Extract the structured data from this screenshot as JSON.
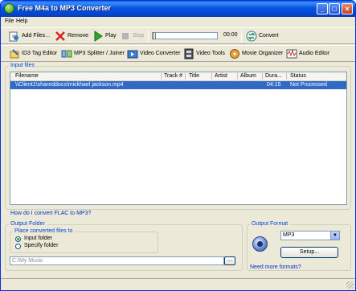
{
  "window": {
    "title": "Free M4a to MP3 Converter"
  },
  "menu": {
    "items": [
      "File",
      "Help"
    ]
  },
  "toolbar": {
    "add_files": "Add Files...",
    "remove": "Remove",
    "play": "Play",
    "stop": "Stop",
    "time": "00:00",
    "convert": "Convert"
  },
  "tools": {
    "items": [
      "ID3 Tag Editor",
      "MP3 Splitter / Joiner",
      "Video Converter",
      "Video Tools",
      "Movie Organizer",
      "Audio Editor"
    ]
  },
  "input_files": {
    "label": "Input files",
    "columns": [
      "Filename",
      "Track #",
      "Title",
      "Artist",
      "Album",
      "Dura...",
      "Status"
    ],
    "rows": [
      {
        "filename": "\\\\Client1\\shareddocs\\mickhael jackson.mp4",
        "track": "",
        "title": "",
        "artist": "",
        "album": "",
        "duration": "04:15",
        "status": "Not Processed"
      }
    ]
  },
  "help_link": "How do I convert FLAC to MP3?",
  "output_folder": {
    "label": "Output Folder",
    "place_label": "Place converted files to",
    "option_input": "Input folder",
    "option_specify": "Specify folder",
    "selected": "Input folder",
    "path_placeholder": "C:\\My Music",
    "browse": "..."
  },
  "output_format": {
    "label": "Output Format",
    "selected": "MP3",
    "setup": "Setup...",
    "more_link": "Need more formats?"
  },
  "colors": {
    "title_bar": "#0654e2",
    "selection": "#316ac5",
    "link": "#0033cc",
    "group_label": "#0046d5"
  }
}
